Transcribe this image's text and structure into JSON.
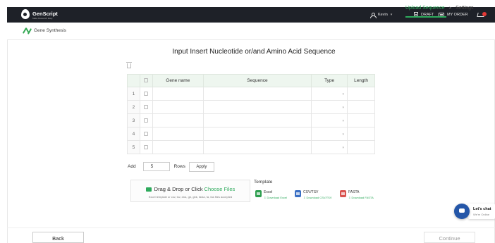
{
  "topbar": {
    "brand": "GenScript",
    "tagline": "Make Research Easy",
    "user_name": "Kevin",
    "draft_label": "DRAFT",
    "myorder_label": "MY ORDER"
  },
  "subheader": {
    "product": "Gene Synthesis",
    "steps": [
      "Upload Sequence",
      "Settings"
    ],
    "step_separator": ">"
  },
  "main": {
    "title": "Input Insert Nucleotide or/and Amino Acid Sequence",
    "table": {
      "headers": [
        "Gene name",
        "Sequence",
        "Type",
        "Length"
      ],
      "rows": [
        {
          "num": "1",
          "gene": "",
          "sequence": "",
          "type": "",
          "length": ""
        },
        {
          "num": "2",
          "gene": "",
          "sequence": "",
          "type": "",
          "length": ""
        },
        {
          "num": "3",
          "gene": "",
          "sequence": "",
          "type": "",
          "length": ""
        },
        {
          "num": "4",
          "gene": "",
          "sequence": "",
          "type": "",
          "length": ""
        },
        {
          "num": "5",
          "gene": "",
          "sequence": "",
          "type": "",
          "length": ""
        }
      ]
    },
    "add_rows": {
      "add_label": "Add",
      "count": "5",
      "rows_label": "Rows",
      "apply_label": "Apply"
    },
    "upload": {
      "drag_text": "Drag & Drop or Click ",
      "choose_files": "Choose Files",
      "hint": "Excel template or csv, tsv, dna, gb, gbk, fasta, fa, fas files accepted"
    },
    "templates": {
      "label": "Template",
      "items": [
        {
          "name": "Excel",
          "download": "Download Excel",
          "color": "#2e9e4f"
        },
        {
          "name": "CSV/TSV",
          "download": "Download CSV/TSV",
          "color": "#3a6fc4"
        },
        {
          "name": "FASTA",
          "download": "Download FASTA",
          "color": "#d9534f"
        }
      ]
    }
  },
  "chat": {
    "title": "Let's chat",
    "status": "We're Online"
  },
  "footer": {
    "back_label": "Back",
    "continue_label": "Continue"
  },
  "colors": {
    "accent": "#2eaa5c",
    "topbar": "#1e2128",
    "chat": "#2456a8"
  }
}
